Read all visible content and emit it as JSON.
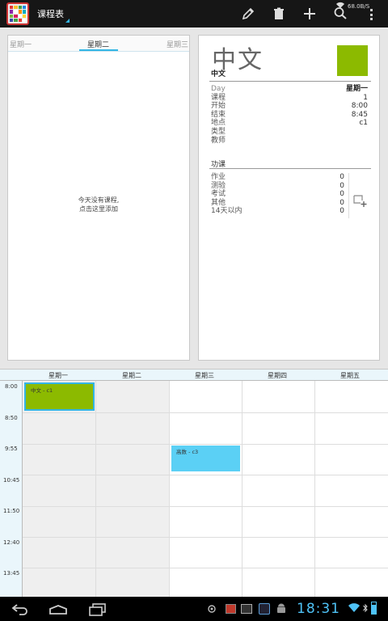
{
  "actionbar": {
    "title": "课程表",
    "status_net": "68.0B/S"
  },
  "day_panel": {
    "tabs": [
      "星期一",
      "星期二",
      "星期三"
    ],
    "empty_line1": "今天没有课程,",
    "empty_line2": "点击这里添加"
  },
  "detail": {
    "big_title": "中文",
    "small_title": "中文",
    "color": "#8cba00",
    "fields": [
      {
        "key": "Day",
        "value": "星期一"
      },
      {
        "key": "课程",
        "value": "1"
      },
      {
        "key": "开始",
        "value": "8:00"
      },
      {
        "key": "结束",
        "value": "8:45"
      },
      {
        "key": "地点",
        "value": "c1"
      },
      {
        "key": "类型",
        "value": ""
      },
      {
        "key": "教师",
        "value": ""
      }
    ],
    "homework_label": "功课",
    "homework": [
      {
        "key": "作业",
        "value": "0"
      },
      {
        "key": "测验",
        "value": "0"
      },
      {
        "key": "考试",
        "value": "0"
      },
      {
        "key": "其他",
        "value": "0"
      },
      {
        "key": "14天以内",
        "value": "0"
      }
    ]
  },
  "week": {
    "days": [
      "星期一",
      "星期二",
      "星期三",
      "星期四",
      "星期五"
    ],
    "times": [
      "8:00",
      "8:50",
      "9:55",
      "10:45",
      "11:50",
      "12:40",
      "13:45"
    ],
    "events": [
      {
        "label": "中文 - c1",
        "color": "#8cba00"
      },
      {
        "label": "高数 - c3",
        "color": "#5bd0f5"
      }
    ]
  },
  "navbar": {
    "clock": "18:31"
  }
}
